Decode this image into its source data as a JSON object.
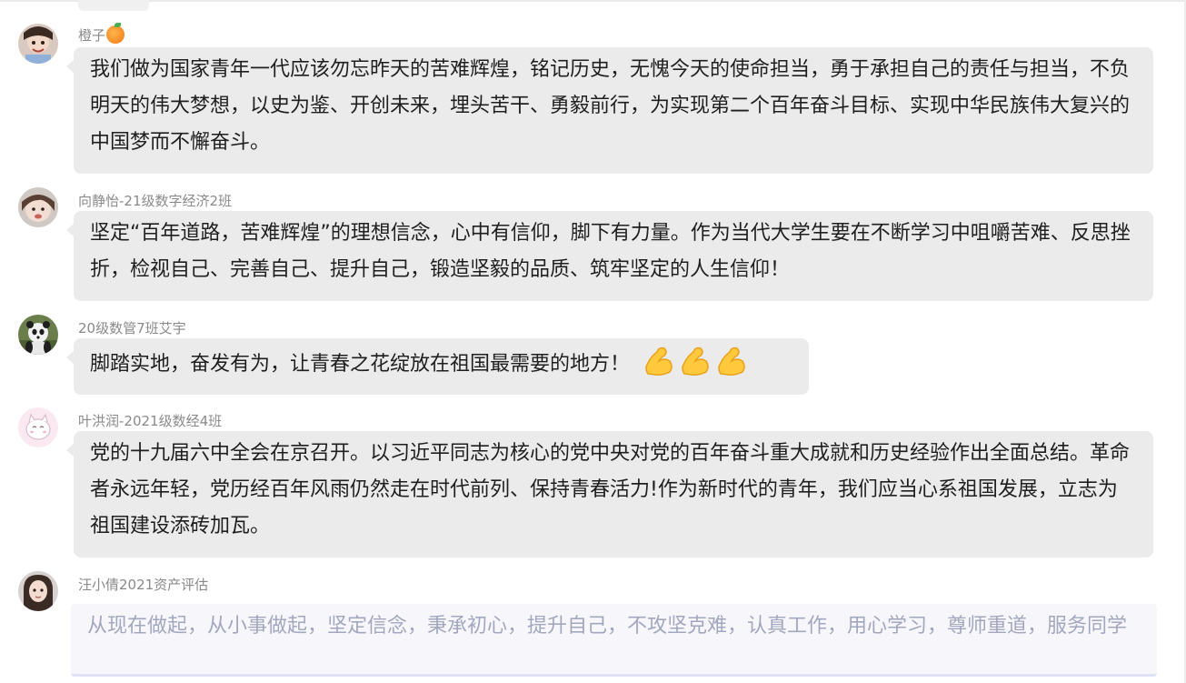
{
  "messages": [
    {
      "sender": "橙子",
      "sender_emoji": "orange-emoji",
      "text": "我们做为国家青年一代应该勿忘昨天的苦难辉煌，铭记历史，无愧今天的使命担当，勇于承担自己的责任与担当，不负明天的伟大梦想，以史为鉴、开创未来，埋头苦干、勇毅前行，为实现第二个百年奋斗目标、实现中华民族伟大复兴的中国梦而不懈奋斗。"
    },
    {
      "sender": "向静怡-21级数字经济2班",
      "text": "坚定“百年道路，苦难辉煌”的理想信念，心中有信仰，脚下有力量。作为当代大学生要在不断学习中咀嚼苦难、反思挫折，检视自己、完善自己、提升自己，锻造坚毅的品质、筑牢坚定的人生信仰！"
    },
    {
      "sender": "20级数管7班艾宇",
      "text": "脚踏实地，奋发有为，让青春之花绽放在祖国最需要的地方！",
      "trailing_emojis": [
        "flexed-biceps-emoji",
        "flexed-biceps-emoji",
        "flexed-biceps-emoji"
      ]
    },
    {
      "sender": "叶洪润-2021级数经4班",
      "text": "党的十九届六中全会在京召开。以习近平同志为核心的党中央对党的百年奋斗重大成就和历史经验作出全面总结。革命者永远年轻，党历经百年风雨仍然走在时代前列、保持青春活力!作为新时代的青年，我们应当心系祖国发展，立志为祖国建设添砖加瓦。"
    },
    {
      "sender": "汪小倩2021资产评估",
      "text": "从现在做起，从小事做起，坚定信念，秉承初心，提升自己，不攻坚克难，认真工作，用心学习，尊师重道，服务同学"
    }
  ],
  "colors": {
    "bubble_bg": "#ebebeb",
    "sender_text": "#8a8a8a",
    "message_text": "#1f1f1f",
    "input_text": "#a2a7bf"
  }
}
